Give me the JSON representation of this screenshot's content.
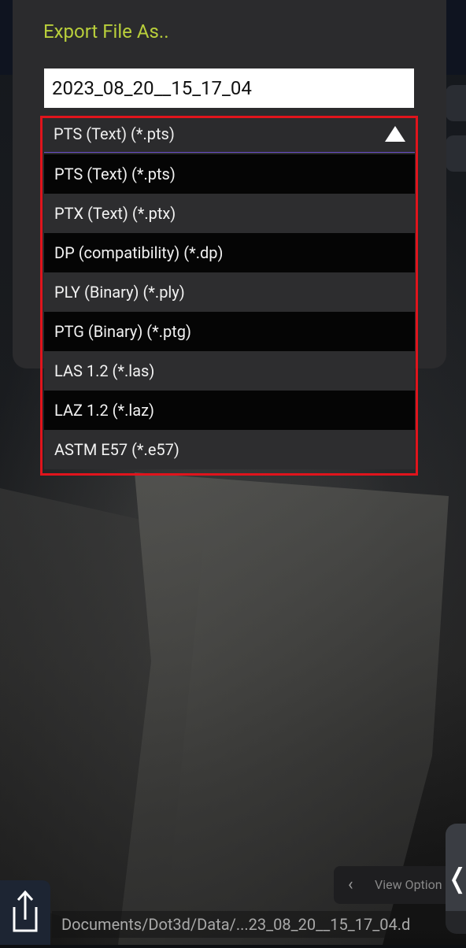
{
  "dialog": {
    "title": "Export File As..",
    "filename_value": "2023_08_20__15_17_04"
  },
  "format_selector": {
    "selected": "PTS (Text) (*.pts)",
    "options": [
      "PTS (Text) (*.pts)",
      "PTX (Text) (*.ptx)",
      "DP (compatibility) (*.dp)",
      "PLY (Binary) (*.ply)",
      "PTG (Binary) (*.ptg)",
      "LAS 1.2 (*.las)",
      "LAZ 1.2 (*.laz)",
      "ASTM E57 (*.e57)"
    ]
  },
  "bottom": {
    "view_options_label": "View Option",
    "path": "Documents/Dot3d/Data/...23_08_20__15_17_04.d"
  },
  "colors": {
    "title_accent": "#b9cf3b",
    "highlight_border": "#e0141c",
    "selector_underline": "#6a4fc7"
  },
  "icons": {
    "dropdown": "triangle-up-icon",
    "export": "share-icon",
    "view_options": "chevron-left-icon",
    "collapse": "chevron-left-icon"
  }
}
